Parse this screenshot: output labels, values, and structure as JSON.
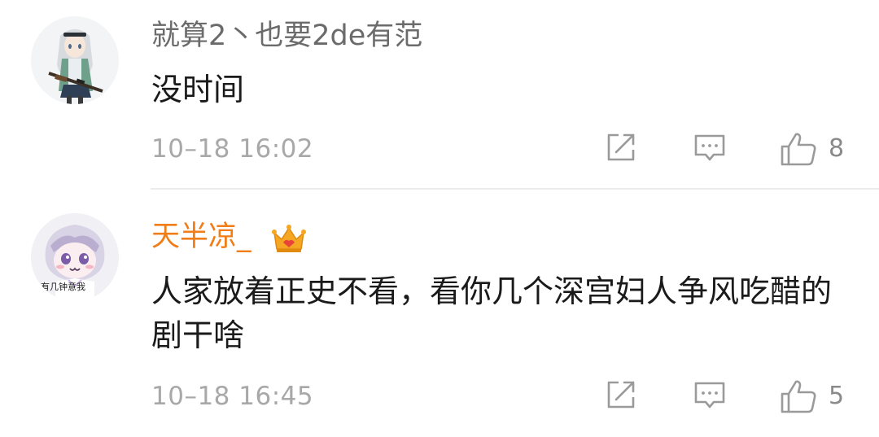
{
  "comments": [
    {
      "username": "就算2丶也要2de有范",
      "content": "没时间",
      "timestamp": "10–18 16:02",
      "likes": "8",
      "username_color": "#6b6b6b",
      "has_crown_badge": false,
      "avatar_icon": "anime-girl-with-rifle-avatar"
    },
    {
      "username": "天半凉_",
      "content": "人家放着正史不看，看你几个深宫妇人争风吃醋的剧干啥",
      "timestamp": "10–18 16:45",
      "likes": "5",
      "username_color": "#f07d18",
      "has_crown_badge": true,
      "avatar_icon": "chibi-girl-avatar",
      "avatar_caption": "有几钟意我"
    }
  ],
  "icons": {
    "share": "share-icon",
    "reply": "reply-icon",
    "like": "thumbs-up-icon",
    "badge": "crown-icon"
  },
  "colors": {
    "icon_gray": "#9a9a9a",
    "divider": "#ececec",
    "crown_orange": "#f5a623"
  }
}
